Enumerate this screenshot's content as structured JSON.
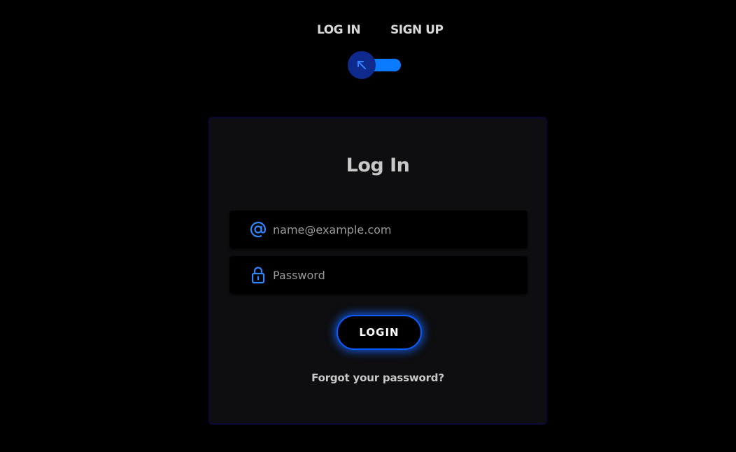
{
  "tabs": {
    "login_label": "LOG IN",
    "signup_label": "SIGN UP"
  },
  "toggle": {
    "state": "login",
    "knob_icon": "arrow-up-left-icon",
    "track_color": "#0a7bff",
    "knob_color": "#0d2a8c"
  },
  "card": {
    "title": "Log In",
    "email": {
      "icon": "at-sign-icon",
      "placeholder": "name@example.com",
      "value": ""
    },
    "password": {
      "icon": "lock-icon",
      "placeholder": "Password",
      "value": ""
    },
    "login_button_label": "LOGIN",
    "forgot_link_label": "Forgot your password?"
  },
  "colors": {
    "background": "#000000",
    "accent": "#0a7bff",
    "card_bg": "#0e0e10"
  }
}
